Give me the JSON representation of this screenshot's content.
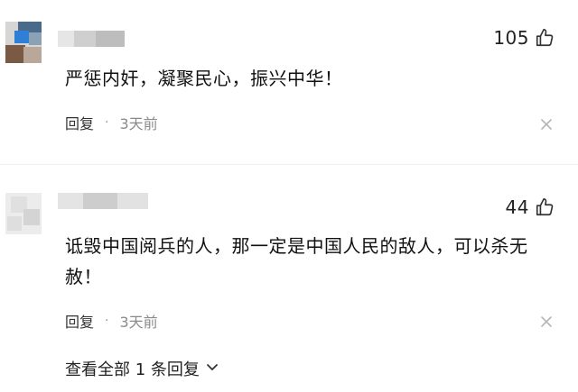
{
  "comments": [
    {
      "likes": "105",
      "text": "严惩内奸，凝聚民心，振兴中华！",
      "reply_label": "回复",
      "separator": "·",
      "time": "3天前"
    },
    {
      "likes": "44",
      "text": "诋毁中国阅兵的人，那一定是中国人民的敌人，可以杀无赦！",
      "reply_label": "回复",
      "separator": "·",
      "time": "3天前"
    }
  ],
  "view_all_replies": "查看全部 1 条回复",
  "icons": {
    "like": "thumbs-up-icon",
    "close": "close-icon",
    "expand": "chevron-down-icon"
  },
  "colors": {
    "text_primary": "#111111",
    "text_secondary": "#8a8a8a",
    "icon": "#333333"
  }
}
